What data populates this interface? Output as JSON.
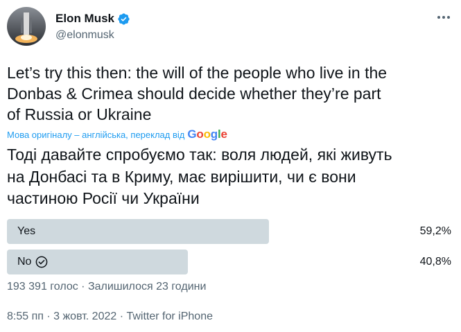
{
  "author": {
    "display_name": "Elon Musk",
    "handle": "@elonmusk",
    "verified": true
  },
  "tweet": {
    "text": "Let’s try this then: the will of the people who live in the\nDonbas & Crimea should decide whether they’re part\nof Russia or Ukraine",
    "translation_note": "Мова оригіналу – англійська, переклад від",
    "translation_provider": "Google",
    "translated_text": "Тоді давайте спробуємо так: воля людей, які живуть\nна Донбасі та в Криму, має вирішити, чи є вони\nчастиною Росії чи України"
  },
  "poll": {
    "options": [
      {
        "label": "Yes",
        "percent_text": "59,2%",
        "fraction": 0.592,
        "selected": false
      },
      {
        "label": "No",
        "percent_text": "40,8%",
        "fraction": 0.408,
        "selected": true
      }
    ],
    "meta": "193 391 голос · Залишилося 23 години"
  },
  "timestamp": "8:55 пп · 3 жовт. 2022 · Twitter for iPhone",
  "colors": {
    "accent": "#1d9bf0",
    "bar": "#cfd9de",
    "secondary_text": "#536471",
    "primary_text": "#0f1419"
  },
  "icons": {
    "verified": "verified-badge-icon",
    "more": "more-dots-icon",
    "selected": "check-circle-icon"
  }
}
